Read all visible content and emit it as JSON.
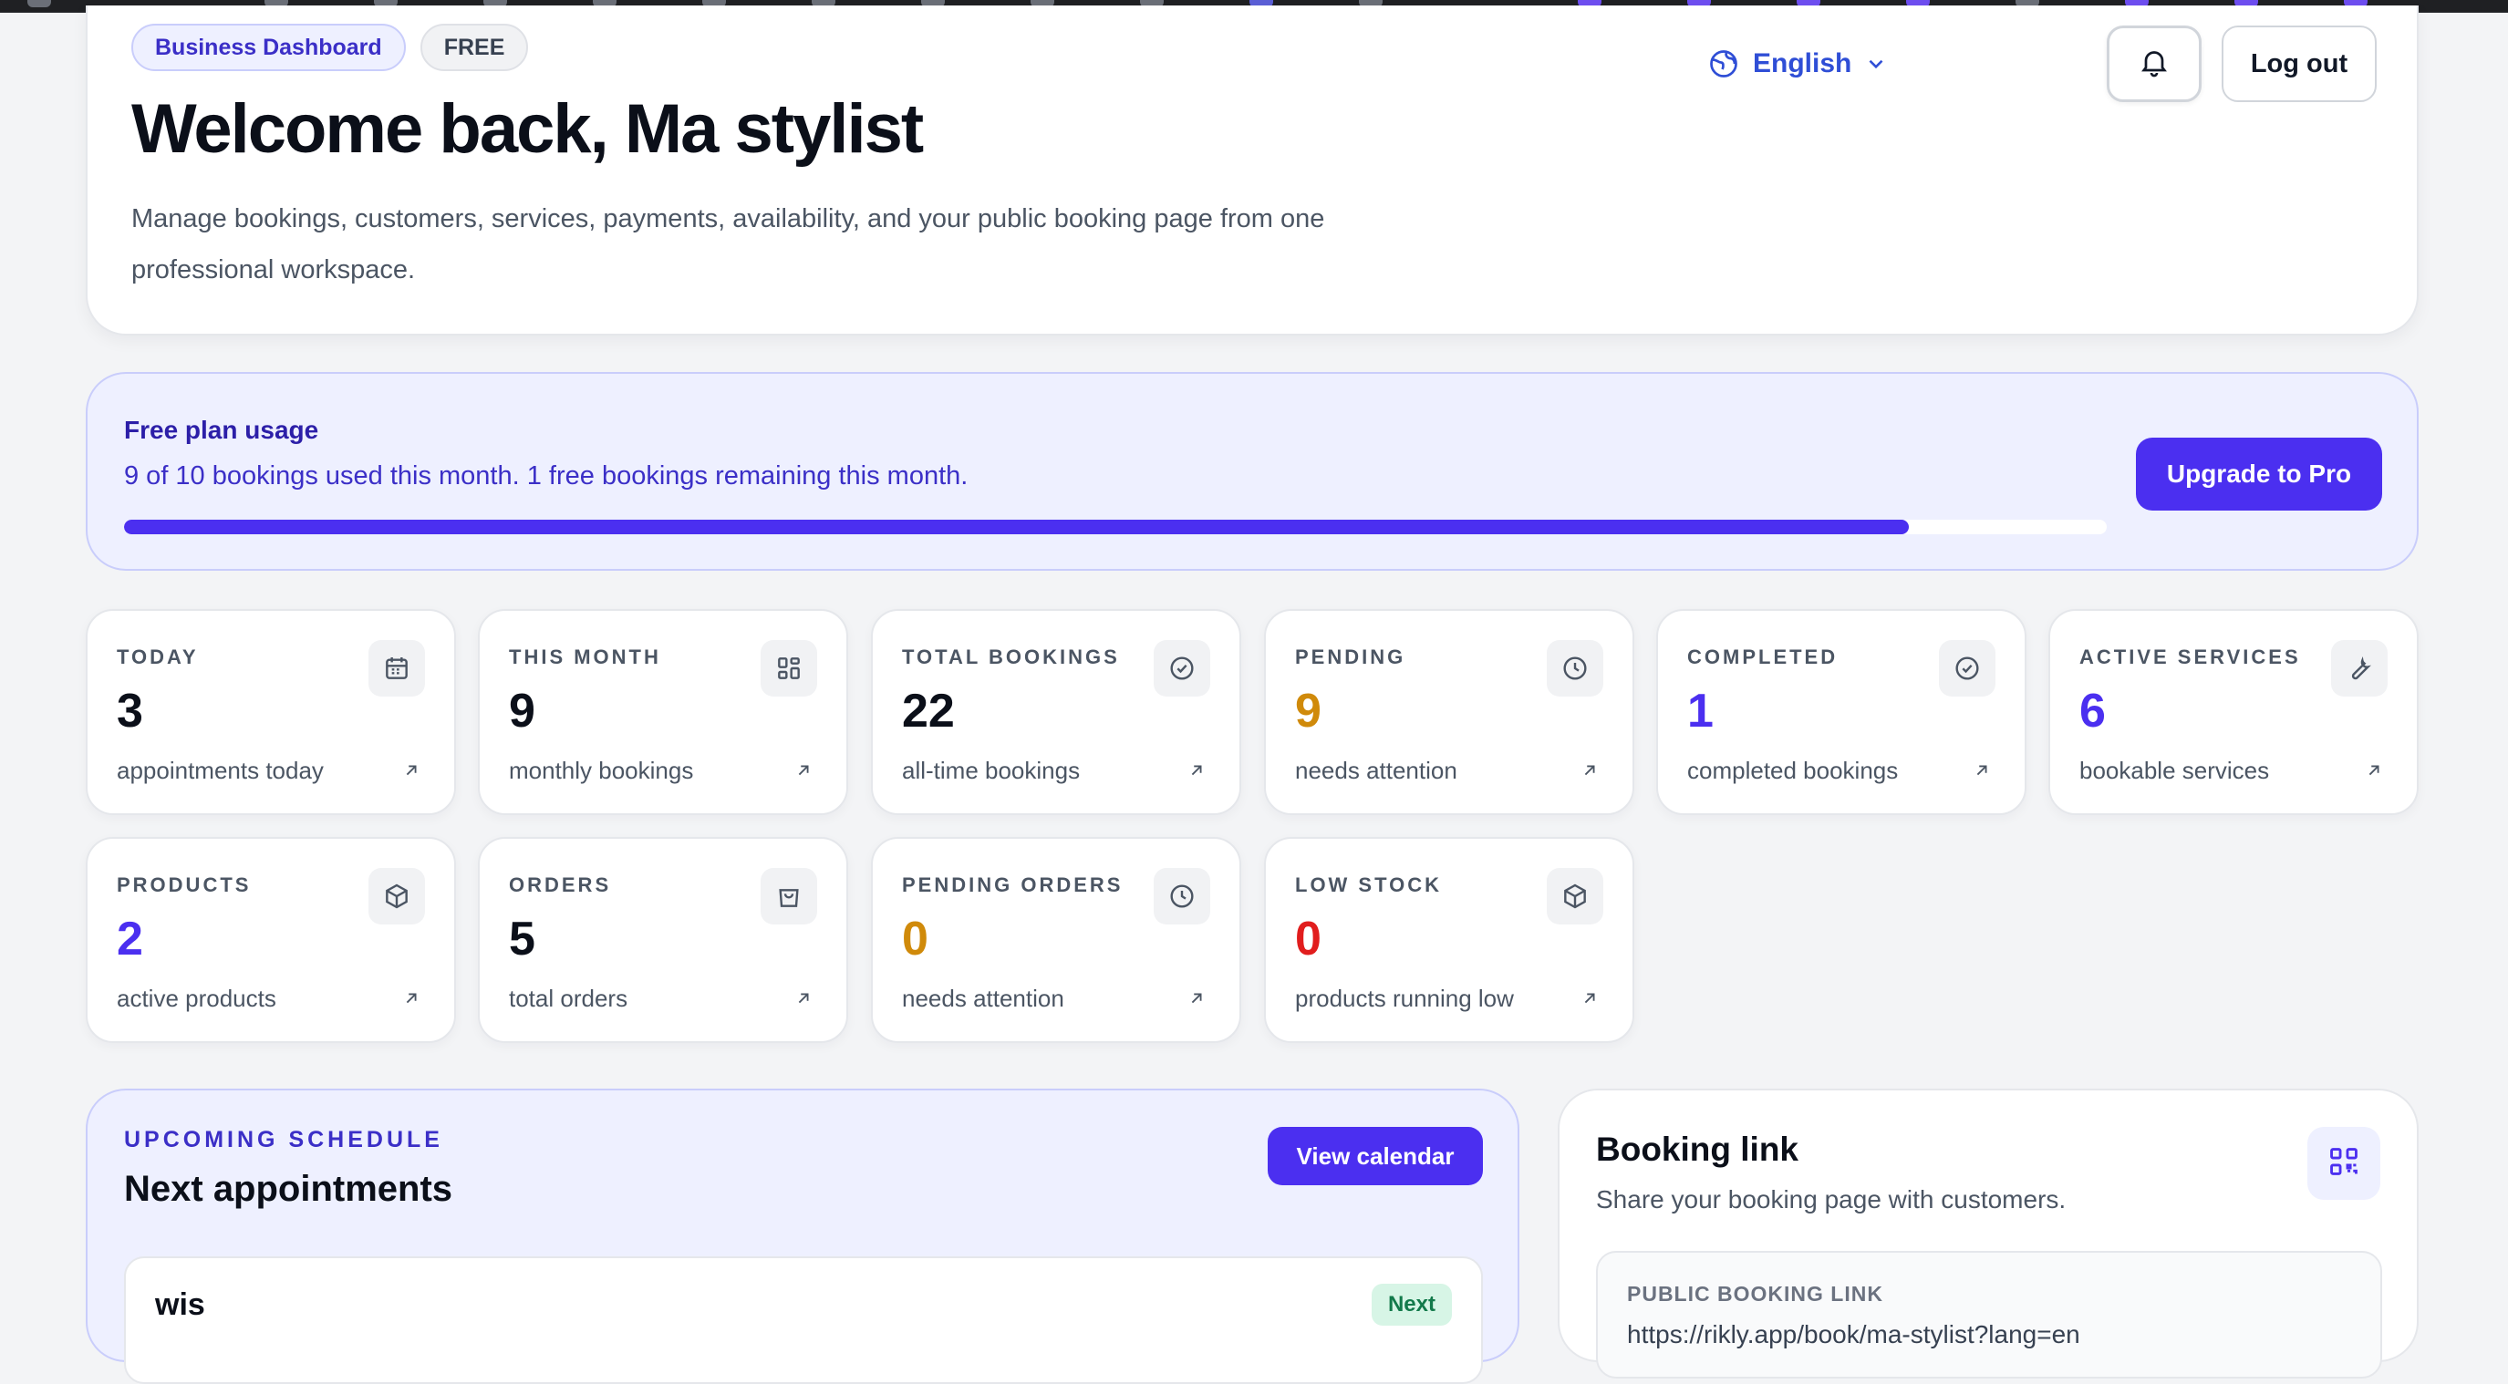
{
  "header": {
    "badge_primary": "Business Dashboard",
    "badge_plan": "FREE",
    "welcome": "Welcome back, Ma stylist",
    "subtitle": "Manage bookings, customers, services, payments, availability, and your public booking page from one professional workspace.",
    "language": "English",
    "logout": "Log out"
  },
  "usage": {
    "title": "Free plan usage",
    "text": "9 of 10 bookings used this month. 1 free bookings remaining this month.",
    "progress_fraction": 0.9,
    "upgrade": "Upgrade to Pro"
  },
  "stats": [
    {
      "label": "TODAY",
      "value": "3",
      "desc": "appointments today",
      "icon": "calendar-icon"
    },
    {
      "label": "THIS MONTH",
      "value": "9",
      "desc": "monthly bookings",
      "icon": "grid-icon"
    },
    {
      "label": "TOTAL BOOKINGS",
      "value": "22",
      "desc": "all-time bookings",
      "icon": "check-circle-icon"
    },
    {
      "label": "PENDING",
      "value": "9",
      "desc": "needs attention",
      "icon": "clock-icon"
    },
    {
      "label": "COMPLETED",
      "value": "1",
      "desc": "completed bookings",
      "icon": "check-circle-icon"
    },
    {
      "label": "ACTIVE SERVICES",
      "value": "6",
      "desc": "bookable services",
      "icon": "wrench-icon"
    },
    {
      "label": "PRODUCTS",
      "value": "2",
      "desc": "active products",
      "icon": "box-icon"
    },
    {
      "label": "ORDERS",
      "value": "5",
      "desc": "total orders",
      "icon": "bag-icon"
    },
    {
      "label": "PENDING ORDERS",
      "value": "0",
      "desc": "needs attention",
      "icon": "clock-icon"
    },
    {
      "label": "LOW STOCK",
      "value": "0",
      "desc": "products running low",
      "icon": "box-icon"
    }
  ],
  "schedule": {
    "eyebrow": "UPCOMING SCHEDULE",
    "title": "Next appointments",
    "view_calendar": "View calendar",
    "appointment_name": "wis",
    "next_badge": "Next"
  },
  "booking": {
    "title": "Booking link",
    "subtitle": "Share your booking page with customers.",
    "link_label": "PUBLIC BOOKING LINK",
    "link_url": "https://rikly.app/book/ma-stylist?lang=en"
  },
  "colors": {
    "accent": "#4b2ff0",
    "amber": "#d08a0a",
    "red": "#e11d1d",
    "background": "#f3f4f6"
  }
}
